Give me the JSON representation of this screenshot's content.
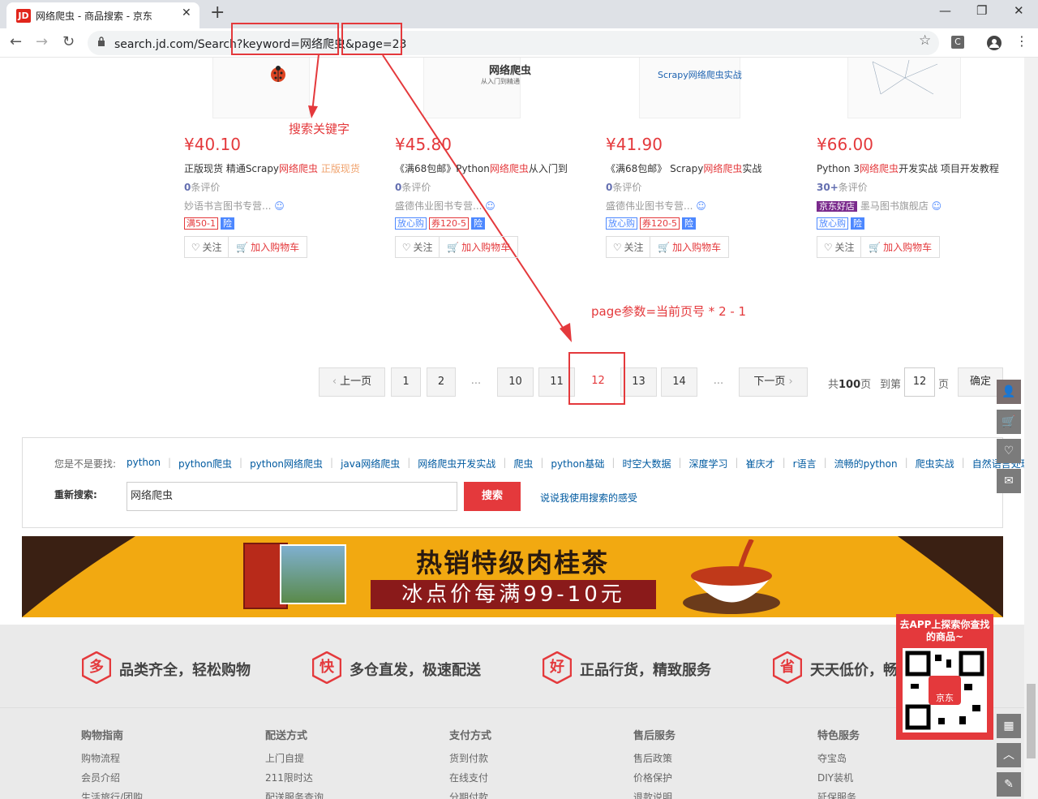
{
  "tab": {
    "title": "网络爬虫 - 商品搜索 - 京东",
    "favicon": "JD"
  },
  "url": {
    "text": "search.jd.com/Search?keyword=网络爬虫&page=23"
  },
  "annotations": {
    "keyword": "搜索关键字",
    "page": "page参数=当前页号 * 2 - 1"
  },
  "products": [
    {
      "price": "¥40.10",
      "title_a": "正版现货 精通Scrapy",
      "title_hl": "网络爬虫",
      "title_b": " ",
      "title_promo": "正版现货",
      "reviews_n": "0",
      "reviews_l": "条评价",
      "shop": "妙语书言图书专营...",
      "badge": "",
      "tags": [
        "满50-1",
        "险"
      ]
    },
    {
      "price": "¥45.80",
      "title_a": "《满68包邮》Python",
      "title_hl": "网络爬虫",
      "title_b": "从入门到",
      "title_promo": "",
      "reviews_n": "0",
      "reviews_l": "条评价",
      "shop": "盛德伟业图书专营...",
      "badge": "",
      "tags": [
        "放心购",
        "券120-5",
        "险"
      ]
    },
    {
      "price": "¥41.90",
      "title_a": "《满68包邮》 Scrapy",
      "title_hl": "网络爬虫",
      "title_b": "实战",
      "title_promo": "",
      "reviews_n": "0",
      "reviews_l": "条评价",
      "shop": "盛德伟业图书专营...",
      "badge": "",
      "tags": [
        "放心购",
        "券120-5",
        "险"
      ]
    },
    {
      "price": "¥66.00",
      "title_a": "Python 3",
      "title_hl": "网络爬虫",
      "title_b": "开发实战 项目开发教程",
      "title_promo": "",
      "reviews_n": "30+",
      "reviews_l": "条评价",
      "shop": "墨马图书旗舰店",
      "badge": "京东好店",
      "tags": [
        "放心购",
        "险"
      ]
    }
  ],
  "actions": {
    "follow": "关注",
    "cart": "加入购物车"
  },
  "book_covers": [
    "网络爬虫",
    "从入门到精通",
    "Scrapy网络爬虫实战"
  ],
  "pagination": {
    "prev": "上一页",
    "pages": [
      "1",
      "2",
      "...",
      "10",
      "11",
      "12",
      "13",
      "14",
      "..."
    ],
    "current": "12",
    "next": "下一页",
    "total_a": "共",
    "total_n": "100",
    "total_b": "页",
    "goto_a": "到第",
    "goto_val": "12",
    "goto_b": "页",
    "confirm": "确定"
  },
  "related": {
    "label": "您是不是要找:",
    "keywords": [
      "python",
      "python爬虫",
      "python网络爬虫",
      "java网络爬虫",
      "网络爬虫开发实战",
      "爬虫",
      "python基础",
      "时空大数据",
      "深度学习",
      "崔庆才",
      "r语言",
      "流畅的python",
      "爬虫实战",
      "自然语言处理"
    ],
    "research_label": "重新搜索:",
    "search_value": "网络爬虫",
    "search_btn": "搜索",
    "feedback": "说说我使用搜索的感受"
  },
  "banner": {
    "title": "热销特级肉桂茶",
    "subtitle": "冰点价每满99-10元"
  },
  "footer": {
    "slogans": [
      {
        "icon": "多",
        "text": "品类齐全，轻松购物"
      },
      {
        "icon": "快",
        "text": "多仓直发，极速配送"
      },
      {
        "icon": "好",
        "text": "正品行货，精致服务"
      },
      {
        "icon": "省",
        "text": "天天低价，畅"
      }
    ],
    "cols": [
      {
        "h": "购物指南",
        "items": [
          "购物流程",
          "会员介绍",
          "生活旅行/团购"
        ]
      },
      {
        "h": "配送方式",
        "items": [
          "上门自提",
          "211限时达",
          "配送服务查询"
        ]
      },
      {
        "h": "支付方式",
        "items": [
          "货到付款",
          "在线支付",
          "分期付款"
        ]
      },
      {
        "h": "售后服务",
        "items": [
          "售后政策",
          "价格保护",
          "退款说明"
        ]
      },
      {
        "h": "特色服务",
        "items": [
          "夺宝岛",
          "DIY装机",
          "延保服务"
        ]
      }
    ]
  },
  "app_promo": {
    "text": "去APP上探索你查找的商品~",
    "logo": "京东"
  }
}
